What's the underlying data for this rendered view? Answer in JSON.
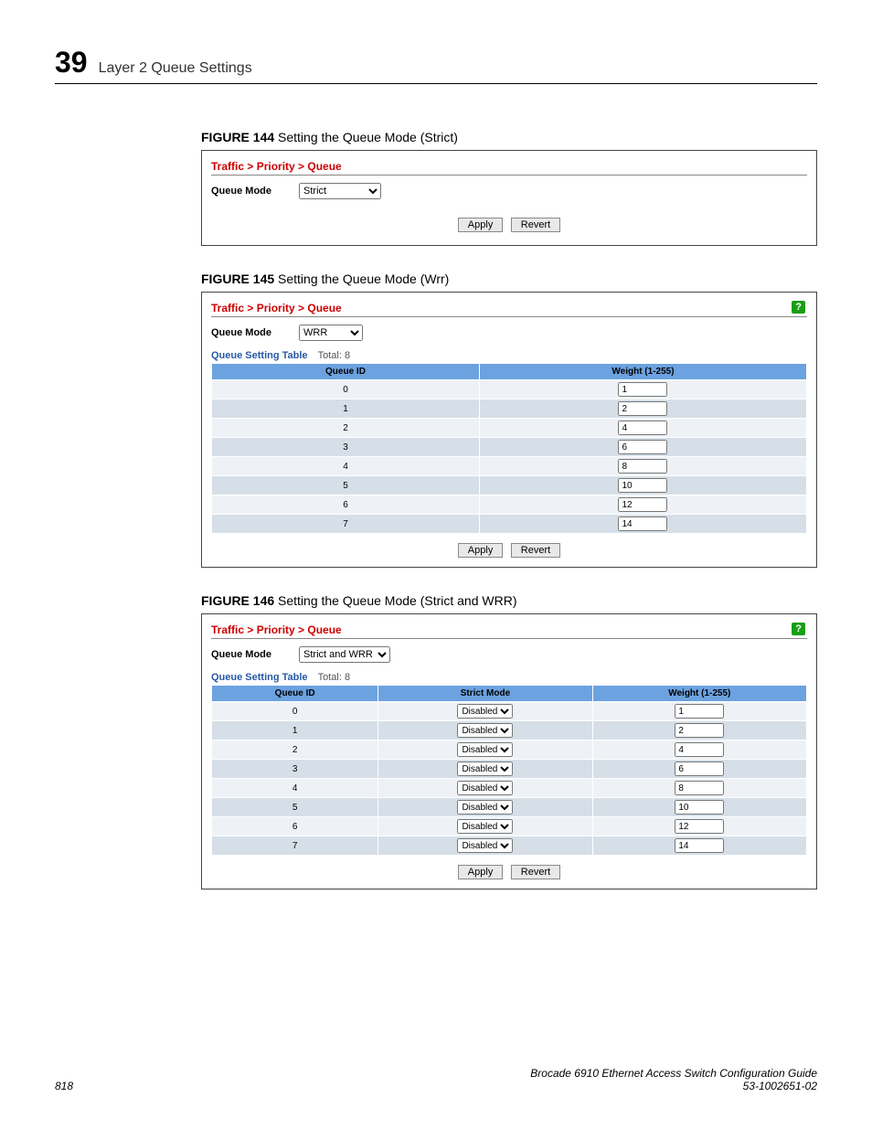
{
  "header": {
    "chapter_num": "39",
    "chapter_title": "Layer 2 Queue Settings"
  },
  "fig144": {
    "caption_num": "FIGURE 144",
    "caption_text": "Setting the Queue Mode (Strict)",
    "breadcrumb": "Traffic > Priority > Queue",
    "mode_label": "Queue Mode",
    "mode_value": "Strict",
    "apply": "Apply",
    "revert": "Revert"
  },
  "fig145": {
    "caption_num": "FIGURE 145",
    "caption_text": "Setting the Queue Mode (Wrr)",
    "breadcrumb": "Traffic > Priority > Queue",
    "help": "?",
    "mode_label": "Queue Mode",
    "mode_value": "WRR",
    "table_title": "Queue Setting Table",
    "total_label": "Total: 8",
    "col_queue": "Queue ID",
    "col_weight": "Weight (1-255)",
    "rows": [
      {
        "id": "0",
        "w": "1"
      },
      {
        "id": "1",
        "w": "2"
      },
      {
        "id": "2",
        "w": "4"
      },
      {
        "id": "3",
        "w": "6"
      },
      {
        "id": "4",
        "w": "8"
      },
      {
        "id": "5",
        "w": "10"
      },
      {
        "id": "6",
        "w": "12"
      },
      {
        "id": "7",
        "w": "14"
      }
    ],
    "apply": "Apply",
    "revert": "Revert"
  },
  "fig146": {
    "caption_num": "FIGURE 146",
    "caption_text": "Setting the Queue Mode (Strict and WRR)",
    "breadcrumb": "Traffic > Priority > Queue",
    "help": "?",
    "mode_label": "Queue Mode",
    "mode_value": "Strict and WRR",
    "table_title": "Queue Setting Table",
    "total_label": "Total: 8",
    "col_queue": "Queue ID",
    "col_strict": "Strict Mode",
    "col_weight": "Weight (1-255)",
    "rows": [
      {
        "id": "0",
        "mode": "Disabled",
        "w": "1"
      },
      {
        "id": "1",
        "mode": "Disabled",
        "w": "2"
      },
      {
        "id": "2",
        "mode": "Disabled",
        "w": "4"
      },
      {
        "id": "3",
        "mode": "Disabled",
        "w": "6"
      },
      {
        "id": "4",
        "mode": "Disabled",
        "w": "8"
      },
      {
        "id": "5",
        "mode": "Disabled",
        "w": "10"
      },
      {
        "id": "6",
        "mode": "Disabled",
        "w": "12"
      },
      {
        "id": "7",
        "mode": "Disabled",
        "w": "14"
      }
    ],
    "apply": "Apply",
    "revert": "Revert"
  },
  "footer": {
    "page": "818",
    "doc_title": "Brocade 6910 Ethernet Access Switch Configuration Guide",
    "doc_num": "53-1002651-02"
  }
}
